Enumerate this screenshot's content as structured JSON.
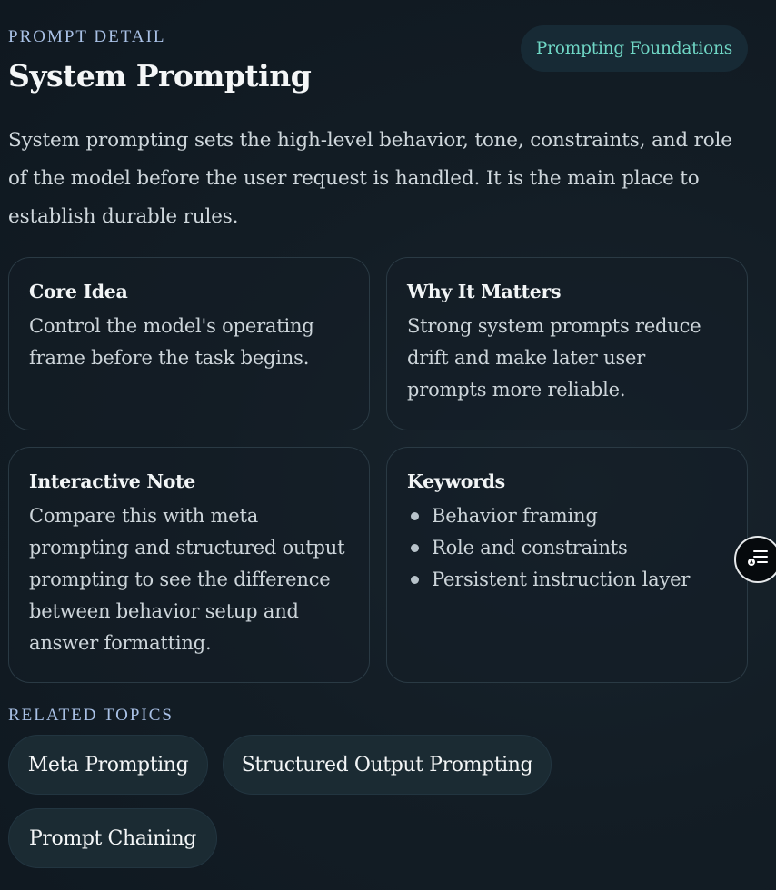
{
  "header": {
    "eyebrow": "PROMPT DETAIL",
    "title": "System Prompting",
    "category_tag": "Prompting Foundations"
  },
  "intro": "System prompting sets the high-level behavior, tone, constraints, and role of the model before the user request is handled. It is the main place to establish durable rules.",
  "cards": {
    "core_idea": {
      "title": "Core Idea",
      "body": "Control the model's operating frame before the task begins."
    },
    "why_it_matters": {
      "title": "Why It Matters",
      "body": "Strong system prompts reduce drift and make later user prompts more reliable."
    },
    "interactive_note": {
      "title": "Interactive Note",
      "body": "Compare this with meta prompting and structured output prompting to see the difference between behavior setup and answer formatting."
    },
    "keywords": {
      "title": "Keywords",
      "items": [
        "Behavior framing",
        "Role and constraints",
        "Persistent instruction layer"
      ]
    }
  },
  "related": {
    "label": "RELATED TOPICS",
    "topics": [
      "Meta Prompting",
      "Structured Output Prompting",
      "Prompt Chaining"
    ]
  },
  "floating_button": {
    "icon": "outline-list-icon"
  },
  "colors": {
    "background": "#131d25",
    "accent_teal": "#6fd6c5",
    "eyebrow_blue": "#a9c1e6",
    "card_border": "#2a3a44",
    "chip_bg": "#1b2b33"
  }
}
